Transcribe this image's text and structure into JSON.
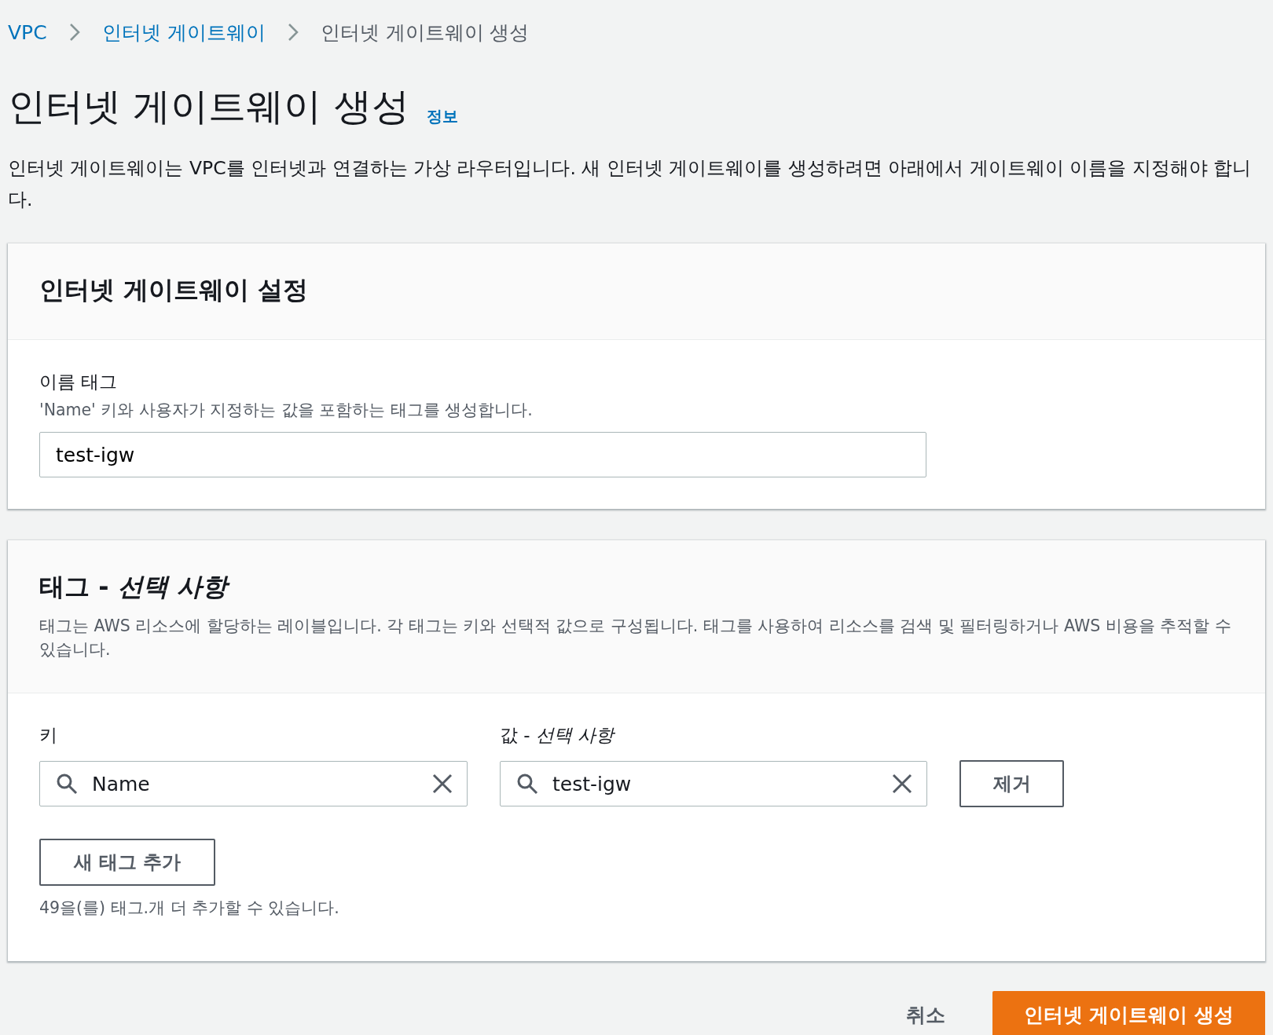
{
  "breadcrumb": [
    {
      "label": "VPC",
      "link": true
    },
    {
      "label": "인터넷 게이트웨이",
      "link": true
    },
    {
      "label": "인터넷 게이트웨이 생성",
      "link": false
    }
  ],
  "page": {
    "title": "인터넷 게이트웨이 생성",
    "info_link": "정보",
    "description": "인터넷 게이트웨이는 VPC를 인터넷과 연결하는 가상 라우터입니다. 새 인터넷 게이트웨이를 생성하려면 아래에서 게이트웨이 이름을 지정해야 합니다."
  },
  "settings": {
    "title": "인터넷 게이트웨이 설정",
    "field_label": "이름 태그",
    "field_hint": "'Name' 키와 사용자가 지정하는 값을 포함하는 태그를 생성합니다.",
    "value": "test-igw"
  },
  "tags": {
    "title": "태그 - ",
    "title_optional": "선택 사항",
    "description": "태그는 AWS 리소스에 할당하는 레이블입니다. 각 태그는 키와 선택적 값으로 구성됩니다. 태그를 사용하여 리소스를 검색 및 필터링하거나 AWS 비용을 추적할 수 있습니다.",
    "key_label": "키",
    "value_label": "값 - *선택 사항*",
    "rows": [
      {
        "key": "Name",
        "value": "test-igw",
        "remove": "제거"
      }
    ],
    "add_button": "새 태그 추가",
    "remaining": "49을(를) 태그.개 더 추가할 수 있습니다."
  },
  "footer": {
    "cancel": "취소",
    "submit": "인터넷 게이트웨이 생성"
  }
}
